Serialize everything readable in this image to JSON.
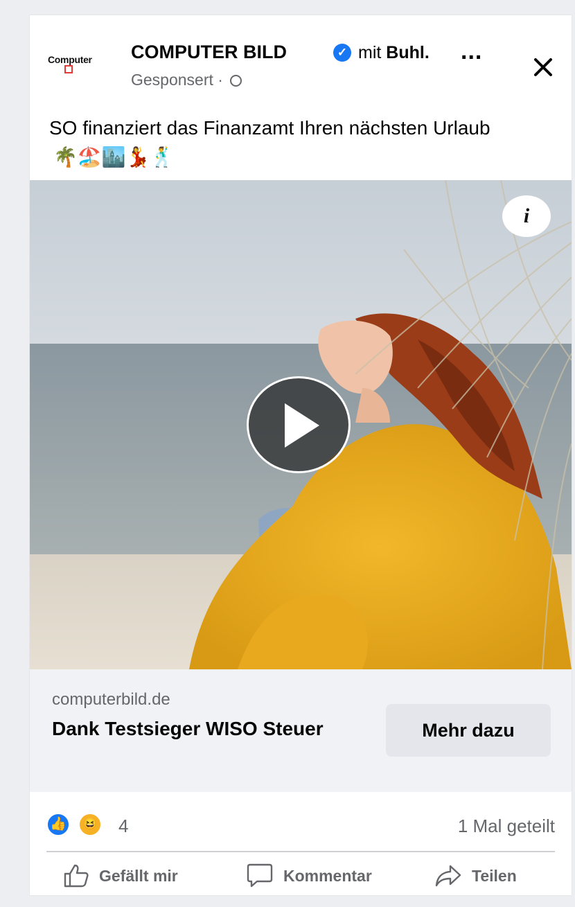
{
  "post": {
    "page_name": "COMPUTER BILD",
    "with_prefix": "mit",
    "partner_name": "Buhl.",
    "sponsored": "Gesponsert ·",
    "logo_text": "Computer",
    "caption": "SO finanziert das Finanzamt Ihren nächsten Urlaub",
    "caption_emojis": "🌴🏖️🏙️💃🕺",
    "more_label": "...",
    "close_icon": "close-icon",
    "info_label": "i"
  },
  "link": {
    "domain": "computerbild.de",
    "headline": "Dank Testsieger WISO Steuer",
    "cta_label": "Mehr dazu"
  },
  "stats": {
    "reaction_count": "4",
    "shares": "1 Mal geteilt"
  },
  "actions": {
    "like_label": "Gefällt mir",
    "comment_label": "Kommentar",
    "share_label": "Teilen"
  },
  "colors": {
    "brand_blue": "#1877f2",
    "text": "#050505",
    "muted": "#65676b",
    "sweater": "#e8a81a"
  }
}
